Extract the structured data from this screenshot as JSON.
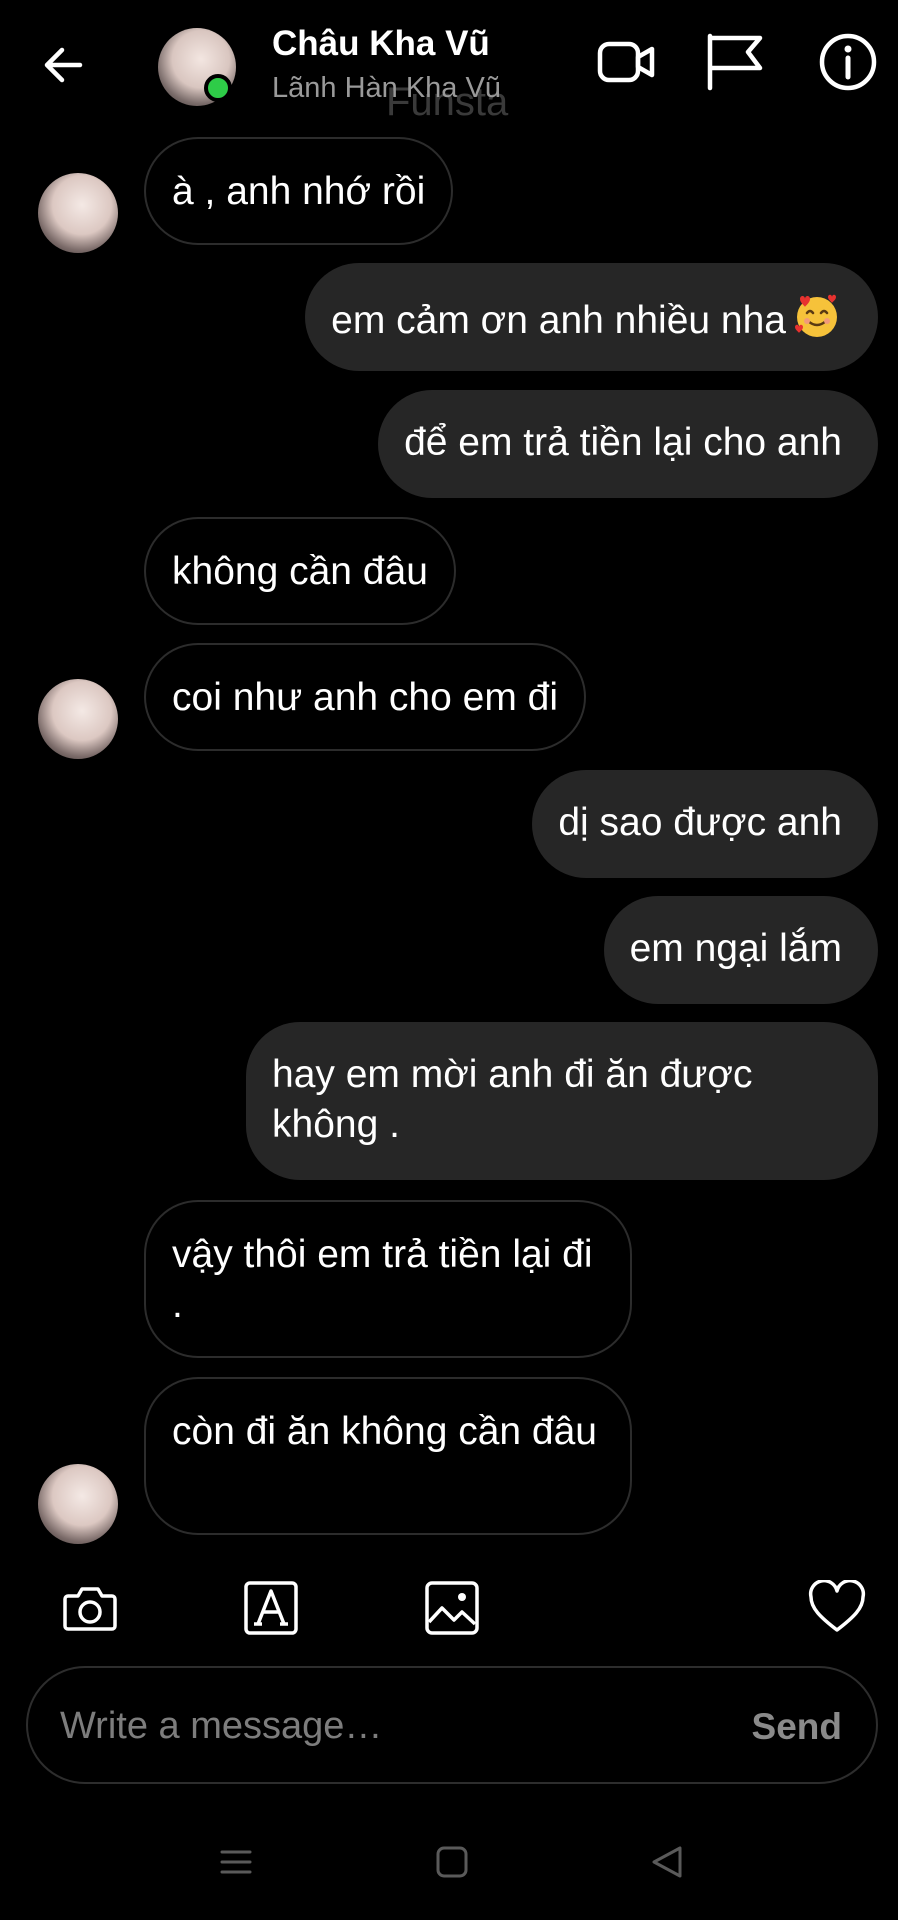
{
  "header": {
    "name": "Châu Kha Vũ",
    "username": "Lãnh Hàn Kha Vũ",
    "watermark": "Funsta",
    "icons": [
      "back-arrow-icon",
      "video-call-icon",
      "flag-icon",
      "info-icon"
    ]
  },
  "messages": [
    {
      "side": "incoming",
      "text": "à , anh nhớ rồi"
    },
    {
      "side": "outgoing",
      "text": "em cảm ơn anh nhiều nha",
      "emoji": "smiling-face-with-hearts"
    },
    {
      "side": "outgoing",
      "text": "để em trả tiền lại cho anh"
    },
    {
      "side": "incoming",
      "text": "không cần đâu"
    },
    {
      "side": "incoming",
      "text": "coi như anh cho em đi"
    },
    {
      "side": "outgoing",
      "text": "dị sao được anh"
    },
    {
      "side": "outgoing",
      "text": "em ngại lắm"
    },
    {
      "side": "outgoing",
      "text": "hay em mời anh đi ăn được không ."
    },
    {
      "side": "incoming",
      "text": "vậy thôi em trả tiền lại đi ."
    },
    {
      "side": "incoming",
      "text": "còn đi ăn không cần đâu"
    }
  ],
  "composer": {
    "placeholder": "Write a message…",
    "send_label": "Send"
  },
  "colors": {
    "background": "#000000",
    "outgoing_bubble": "#262626",
    "incoming_border": "#2c2c2c",
    "online": "#2ecc48",
    "muted_text": "#9a9a9a"
  }
}
